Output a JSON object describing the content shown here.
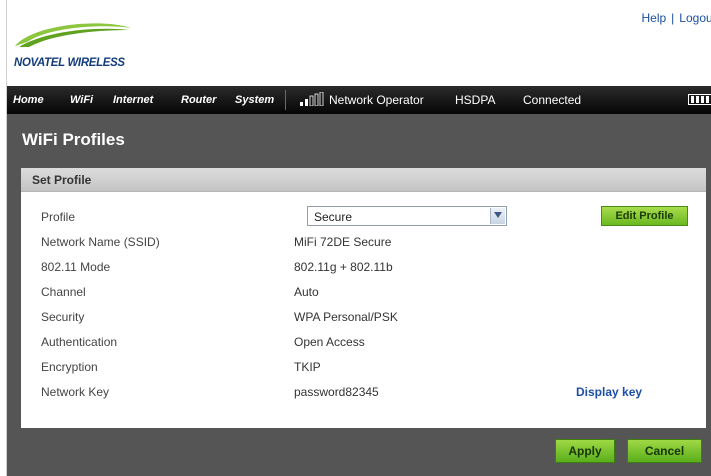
{
  "header": {
    "logo_text": "NOVATEL WIRELESS",
    "links": {
      "help": "Help",
      "separator": "|",
      "logout": "Logout"
    }
  },
  "nav": {
    "items": [
      {
        "label": "Home"
      },
      {
        "label": "WiFi"
      },
      {
        "label": "Internet"
      },
      {
        "label": "Router"
      },
      {
        "label": "System"
      }
    ],
    "status": {
      "operator": "Network Operator",
      "network_type": "HSDPA",
      "connection": "Connected"
    }
  },
  "page": {
    "title": "WiFi Profiles",
    "panel_title": "Set Profile",
    "profile": {
      "label": "Profile",
      "selected": "Secure"
    },
    "edit_profile_label": "Edit Profile",
    "rows": [
      {
        "label": "Network Name (SSID)",
        "value": "MiFi 72DE Secure"
      },
      {
        "label": "802.11 Mode",
        "value": "802.11g + 802.11b"
      },
      {
        "label": "Channel",
        "value": "Auto"
      },
      {
        "label": "Security",
        "value": "WPA Personal/PSK"
      },
      {
        "label": "Authentication",
        "value": "Open Access"
      },
      {
        "label": "Encryption",
        "value": "TKIP"
      },
      {
        "label": "Network Key",
        "value": "password82345"
      }
    ],
    "display_key_label": "Display key",
    "apply_label": "Apply",
    "cancel_label": "Cancel"
  },
  "colors": {
    "accent_green": "#7ac22a",
    "link_blue": "#1c4fa6",
    "logo_blue": "#143c7a",
    "content_bg": "#555555"
  }
}
